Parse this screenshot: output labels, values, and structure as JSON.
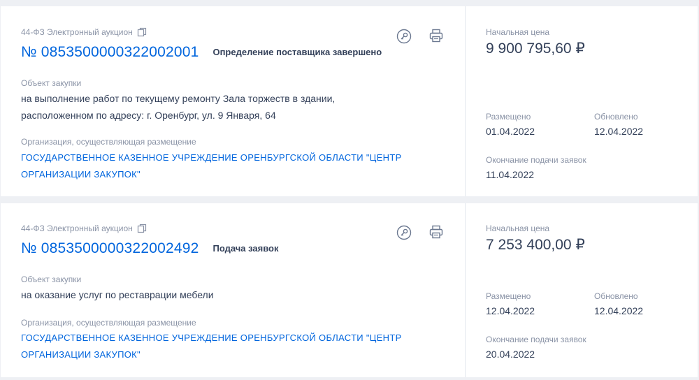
{
  "purchases": [
    {
      "type": "44-ФЗ Электронный аукцион",
      "number": "№ 0853500000322002001",
      "status": "Определение поставщика завершено",
      "object_label": "Объект закупки",
      "object_text_1": "на выполнение работ по текущему ремонту Зала торжеств в здании,",
      "object_text_2": "расположенном по адресу: г. Оренбург, ул. 9 Января, 64",
      "org_label": "Организация, осуществляющая размещение",
      "org_name_1": "ГОСУДАРСТВЕННОЕ КАЗЕННОЕ УЧРЕЖДЕНИЕ ОРЕНБУРГСКОЙ ОБЛАСТИ \"ЦЕНТР",
      "org_name_2": "ОРГАНИЗАЦИИ ЗАКУПОК\"",
      "price_label": "Начальная цена",
      "price": "9 900 795,60 ₽",
      "placed_label": "Размещено",
      "placed": "01.04.2022",
      "updated_label": "Обновлено",
      "updated": "12.04.2022",
      "deadline_label": "Окончание подачи заявок",
      "deadline": "11.04.2022"
    },
    {
      "type": "44-ФЗ Электронный аукцион",
      "number": "№ 0853500000322002492",
      "status": "Подача заявок",
      "object_label": "Объект закупки",
      "object_text_1": "на оказание услуг по реставрации мебели",
      "org_label": "Организация, осуществляющая размещение",
      "org_name_1": "ГОСУДАРСТВЕННОЕ КАЗЕННОЕ УЧРЕЖДЕНИЕ ОРЕНБУРГСКОЙ ОБЛАСТИ \"ЦЕНТР",
      "org_name_2": "ОРГАНИЗАЦИИ ЗАКУПОК\"",
      "price_label": "Начальная цена",
      "price": "7 253 400,00 ₽",
      "placed_label": "Размещено",
      "placed": "12.04.2022",
      "updated_label": "Обновлено",
      "updated": "12.04.2022",
      "deadline_label": "Окончание подачи заявок",
      "deadline": "20.04.2022"
    }
  ],
  "icons": {
    "copy": "copy-icon",
    "key": "key-icon",
    "print": "print-icon"
  },
  "colors": {
    "link": "#0065dd",
    "text": "#334059",
    "muted": "#8a93a6",
    "background": "#eef0f4"
  }
}
